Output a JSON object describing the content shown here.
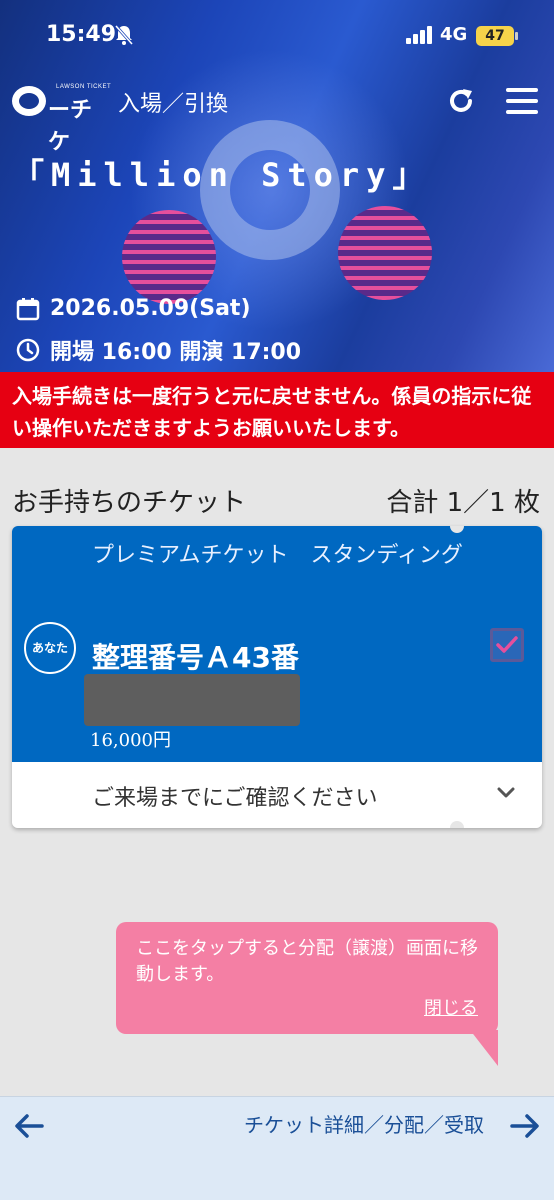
{
  "status_bar": {
    "time": "15:49",
    "network": "4G",
    "battery": "47",
    "icons": [
      "mute-bell-icon",
      "signal-icon",
      "battery-icon"
    ]
  },
  "header": {
    "logo_small": "LAWSON TICKET",
    "logo_text": "ーチケ",
    "title": "入場／引換",
    "icons": [
      "refresh-icon",
      "menu-icon"
    ]
  },
  "event": {
    "title": "「Million Story」",
    "date": "2026.05.09(Sat)",
    "times": "開場 16:00 開演 17:00",
    "icons": [
      "calendar-icon",
      "clock-icon"
    ]
  },
  "warning": {
    "text": "入場手続きは一度行うと元に戻せません。係員の指示に従い操作いただきますようお願いいたします。"
  },
  "tickets_section": {
    "title": "お手持ちのチケット",
    "total": "合計 1／1 枚"
  },
  "ticket": {
    "type": "プレミアムチケット　スタンディング",
    "owner_badge": "あなた",
    "number": "整理番号Ａ43番",
    "price": "16,000円",
    "checked": true,
    "confirm_label": "ご来場までにご確認ください"
  },
  "tooltip": {
    "message": "ここをタップすると分配（譲渡）画面に移動します。",
    "close_label": "閉じる"
  },
  "bottom_bar": {
    "link_label": "チケット詳細／分配／受取",
    "icons": [
      "arrow-left-icon",
      "arrow-right-icon"
    ]
  },
  "colors": {
    "header_blue": "#1c45b8",
    "warning_red": "#e60012",
    "ticket_blue": "#0068c1",
    "tooltip_pink": "#f47fa4",
    "check_pink": "#e64f9c",
    "link_blue": "#1a4f97"
  }
}
